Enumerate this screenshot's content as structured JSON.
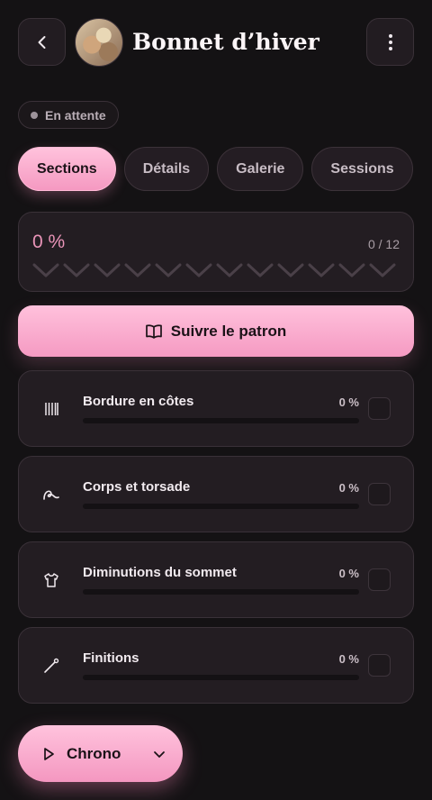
{
  "header": {
    "title": "Bonnet d’hiver",
    "back_icon": "chevron-left-icon",
    "menu_icon": "more-vertical-icon"
  },
  "status": {
    "label": "En attente"
  },
  "tabs": [
    {
      "label": "Sections",
      "active": true
    },
    {
      "label": "Détails",
      "active": false
    },
    {
      "label": "Galerie",
      "active": false
    },
    {
      "label": "Sessions",
      "active": false
    }
  ],
  "progress": {
    "percent_label": "0 %",
    "count_label": "0 / 12",
    "fraction": 0,
    "steps_total": 12,
    "steps_done": 0
  },
  "follow_button": {
    "label": "Suivre le patron",
    "icon": "book-open-icon"
  },
  "sections": [
    {
      "name": "Bordure en côtes",
      "percent": "0 %",
      "icon": "ribbing-icon",
      "fraction": 0,
      "checked": false
    },
    {
      "name": "Corps et torsade",
      "percent": "0 %",
      "icon": "yarn-loop-icon",
      "fraction": 0,
      "checked": false
    },
    {
      "name": "Diminutions du sommet",
      "percent": "0 %",
      "icon": "shirt-icon",
      "fraction": 0,
      "checked": false
    },
    {
      "name": "Finitions",
      "percent": "0 %",
      "icon": "needle-icon",
      "fraction": 0,
      "checked": false
    }
  ],
  "chrono": {
    "label": "Chrono",
    "icon": "play-icon",
    "caret_icon": "chevron-down-icon"
  },
  "colors": {
    "accent": "#f7a6c9",
    "background": "#141214",
    "card": "#231d22"
  }
}
